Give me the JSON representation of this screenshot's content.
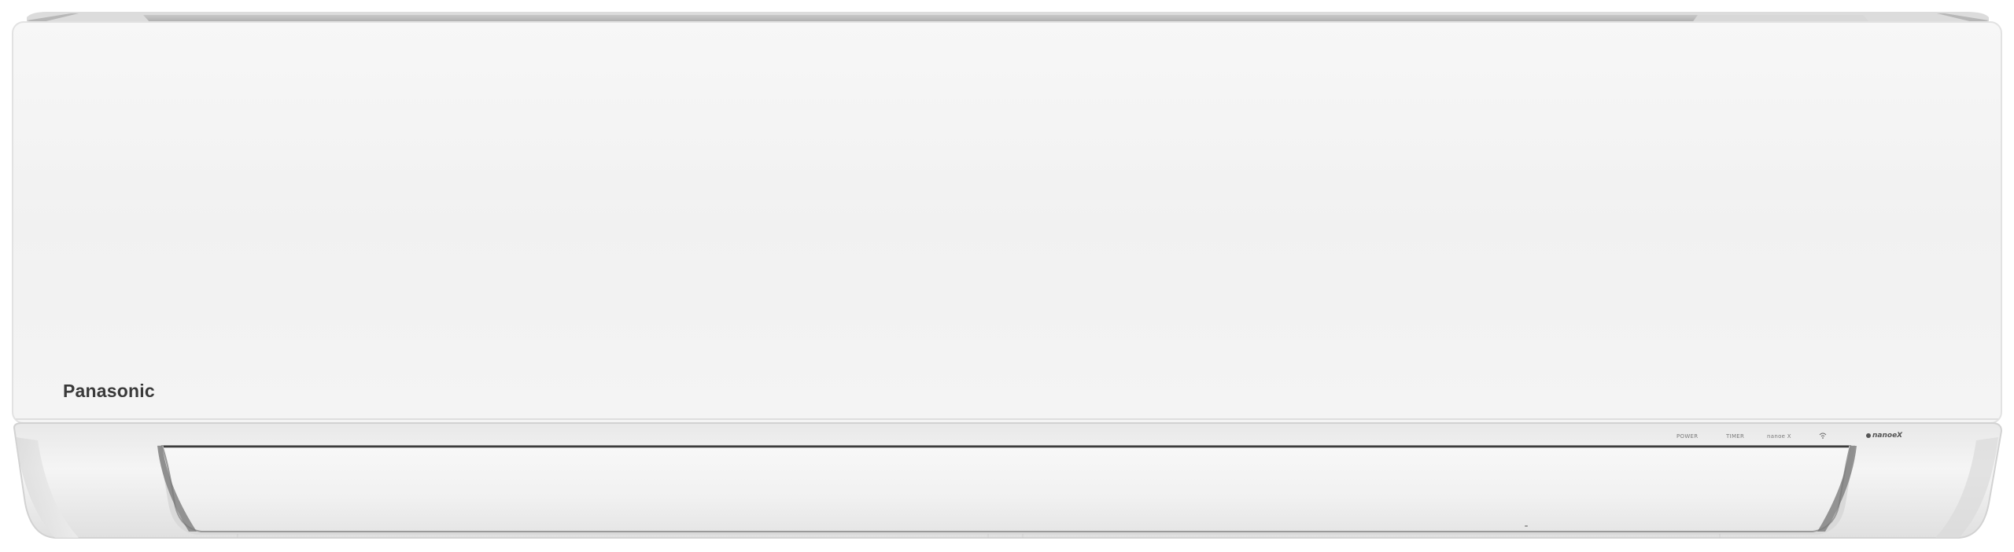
{
  "product": {
    "brand_logo": "Panasonic",
    "indicators": {
      "power": "POWER",
      "timer": "TIMER",
      "nanoe": "nanoe X"
    },
    "wifi_icon": "wifi-icon",
    "nanoex_logo": "nanoeX"
  },
  "colors": {
    "body": "#f1f1f1",
    "trim": "#b5b5b5",
    "brand_text": "#3a3a3a"
  }
}
